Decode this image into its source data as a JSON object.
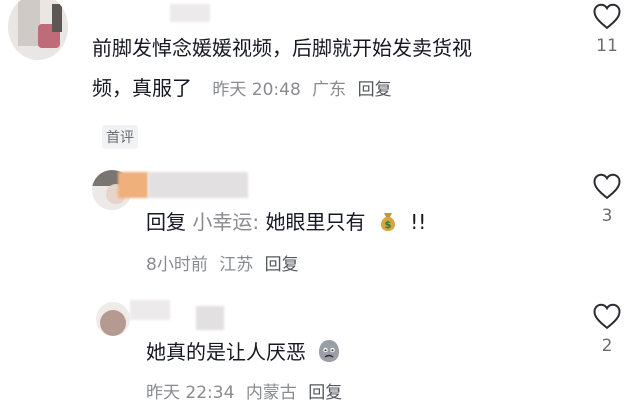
{
  "comments": [
    {
      "lines": [
        "前脚发悼念媛媛视频，后脚就开始发卖货视",
        "频，真服了"
      ],
      "time": "昨天 20:48",
      "location": "广东",
      "reply_label": "回复",
      "likes": "11",
      "badge": "首评"
    },
    {
      "prefix": "回复",
      "reply_name": "小幸运:",
      "text": "她眼里只有",
      "emoji": "money-bag-emoji",
      "suffix": "!!",
      "time": "8小时前",
      "location": "江苏",
      "reply_label": "回复",
      "likes": "3"
    },
    {
      "text": "她真的是让人厌恶",
      "emoji": "disgusted-face-emoji",
      "time": "昨天 22:34",
      "location": "内蒙古",
      "reply_label": "回复",
      "likes": "2"
    }
  ]
}
